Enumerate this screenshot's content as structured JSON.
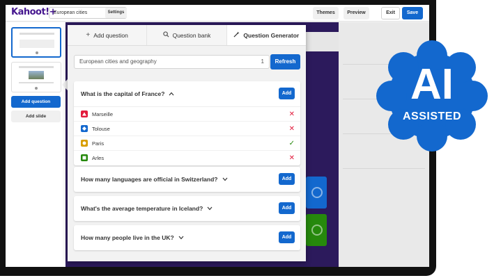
{
  "app": {
    "logo": "Kahoot!+",
    "title_value": "European cities",
    "settings_label": "Settings",
    "themes_label": "Themes",
    "preview_label": "Preview",
    "exit_label": "Exit",
    "save_label": "Save"
  },
  "rail": {
    "add_question_label": "Add question",
    "add_slide_label": "Add slide"
  },
  "tabs": [
    {
      "label": "Add question",
      "icon": "plus-icon",
      "active": false
    },
    {
      "label": "Question bank",
      "icon": "search-icon",
      "active": false
    },
    {
      "label": "Question Generator",
      "icon": "wand-icon",
      "active": true
    }
  ],
  "generator": {
    "prompt_value": "European cities and geography",
    "count_value": "1",
    "refresh_label": "Refresh"
  },
  "questions": [
    {
      "text": "What is the capital of France?",
      "expanded": true,
      "add_label": "Add",
      "answers": [
        {
          "text": "Marseille",
          "shape": "triangle",
          "color": "#e21b3c",
          "correct": false
        },
        {
          "text": "Tolouse",
          "shape": "diamond",
          "color": "#1368ce",
          "correct": false
        },
        {
          "text": "Paris",
          "shape": "circle",
          "color": "#d89e00",
          "correct": true
        },
        {
          "text": "Arles",
          "shape": "square",
          "color": "#26890c",
          "correct": false
        }
      ]
    },
    {
      "text": "How many languages are official in Switzerland?",
      "expanded": false,
      "add_label": "Add"
    },
    {
      "text": "What's the average temperature in Iceland?",
      "expanded": false,
      "add_label": "Add"
    },
    {
      "text": "How many people live in the UK?",
      "expanded": false,
      "add_label": "Add"
    }
  ],
  "badge": {
    "big": "AI",
    "small": "ASSISTED",
    "color": "#1368ce"
  },
  "colors": {
    "primary": "#1368ce",
    "brand": "#46178f",
    "correct": "#26890c",
    "wrong": "#e21b3c"
  }
}
